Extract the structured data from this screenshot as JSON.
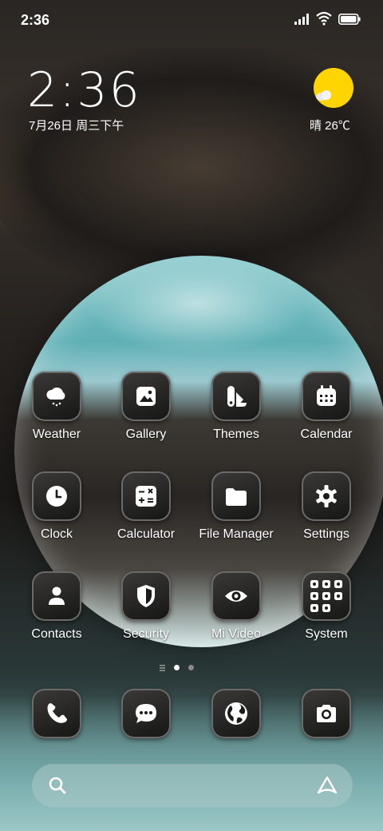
{
  "status": {
    "time": "2:36"
  },
  "widget": {
    "clock": "2:36",
    "date": "7月26日 周三下午",
    "weather": "晴 26℃"
  },
  "apps": [
    {
      "label": "Weather",
      "icon": "weather-icon"
    },
    {
      "label": "Gallery",
      "icon": "gallery-icon"
    },
    {
      "label": "Themes",
      "icon": "themes-icon"
    },
    {
      "label": "Calendar",
      "icon": "calendar-icon"
    },
    {
      "label": "Clock",
      "icon": "clock-icon"
    },
    {
      "label": "Calculator",
      "icon": "calculator-icon"
    },
    {
      "label": "File Manager",
      "icon": "folder-icon"
    },
    {
      "label": "Settings",
      "icon": "gear-icon"
    },
    {
      "label": "Contacts",
      "icon": "person-icon"
    },
    {
      "label": "Security",
      "icon": "shield-icon"
    },
    {
      "label": "Mi Video",
      "icon": "eye-icon"
    },
    {
      "label": "System",
      "icon": "folder-grid-icon"
    }
  ],
  "dock": [
    {
      "icon": "phone-icon"
    },
    {
      "icon": "message-icon"
    },
    {
      "icon": "browser-globe-icon"
    },
    {
      "icon": "camera-icon"
    }
  ],
  "pages": {
    "count": 2,
    "current": 1
  },
  "colors": {
    "tile_border": "#6b6a68",
    "sun": "#ffd400",
    "search_bg": "#aac8c6"
  }
}
